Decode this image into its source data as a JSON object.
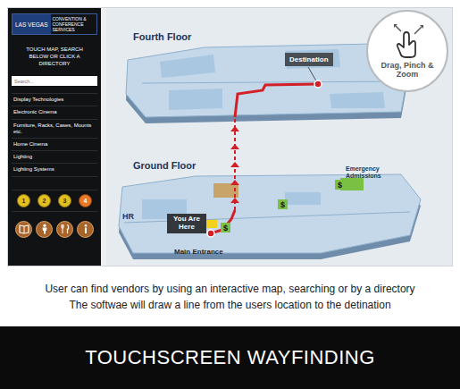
{
  "sidebar": {
    "logo": {
      "primary": "LAS VEGAS",
      "secondary": "CONVENTION & CONFERENCE SERVICES"
    },
    "prompt": "TOUCH MAP, SEARCH BELOW OR CLICK A DIRECTORY",
    "search": {
      "placeholder": "Search..."
    },
    "directory": [
      "Display Technologies",
      "Electronic Cinema",
      "Furniture, Racks, Cases, Mounts etc.",
      "Home Cinema",
      "Lighting",
      "Lighting Systems"
    ],
    "floors": [
      {
        "label": "1",
        "selected": false
      },
      {
        "label": "2",
        "selected": false
      },
      {
        "label": "3",
        "selected": false
      },
      {
        "label": "4",
        "selected": true
      }
    ]
  },
  "map": {
    "floors": [
      {
        "label": "Fourth Floor"
      },
      {
        "label": "Ground Floor"
      }
    ],
    "destination": "Destination",
    "origin": "You Are Here",
    "entrance": "Main Entrance",
    "areas": [
      "Emergency Admissions",
      "HR"
    ],
    "glyphs": [
      "$",
      "$",
      "$"
    ],
    "gesture_hint": "Drag, Pinch & Zoom"
  },
  "caption": [
    "User can find vendors by using an interactive map, searching or by a directory",
    "The softwae will draw a line from the users location to the detination"
  ],
  "footer": {
    "title": "TOUCHSCREEN WAYFINDING"
  }
}
